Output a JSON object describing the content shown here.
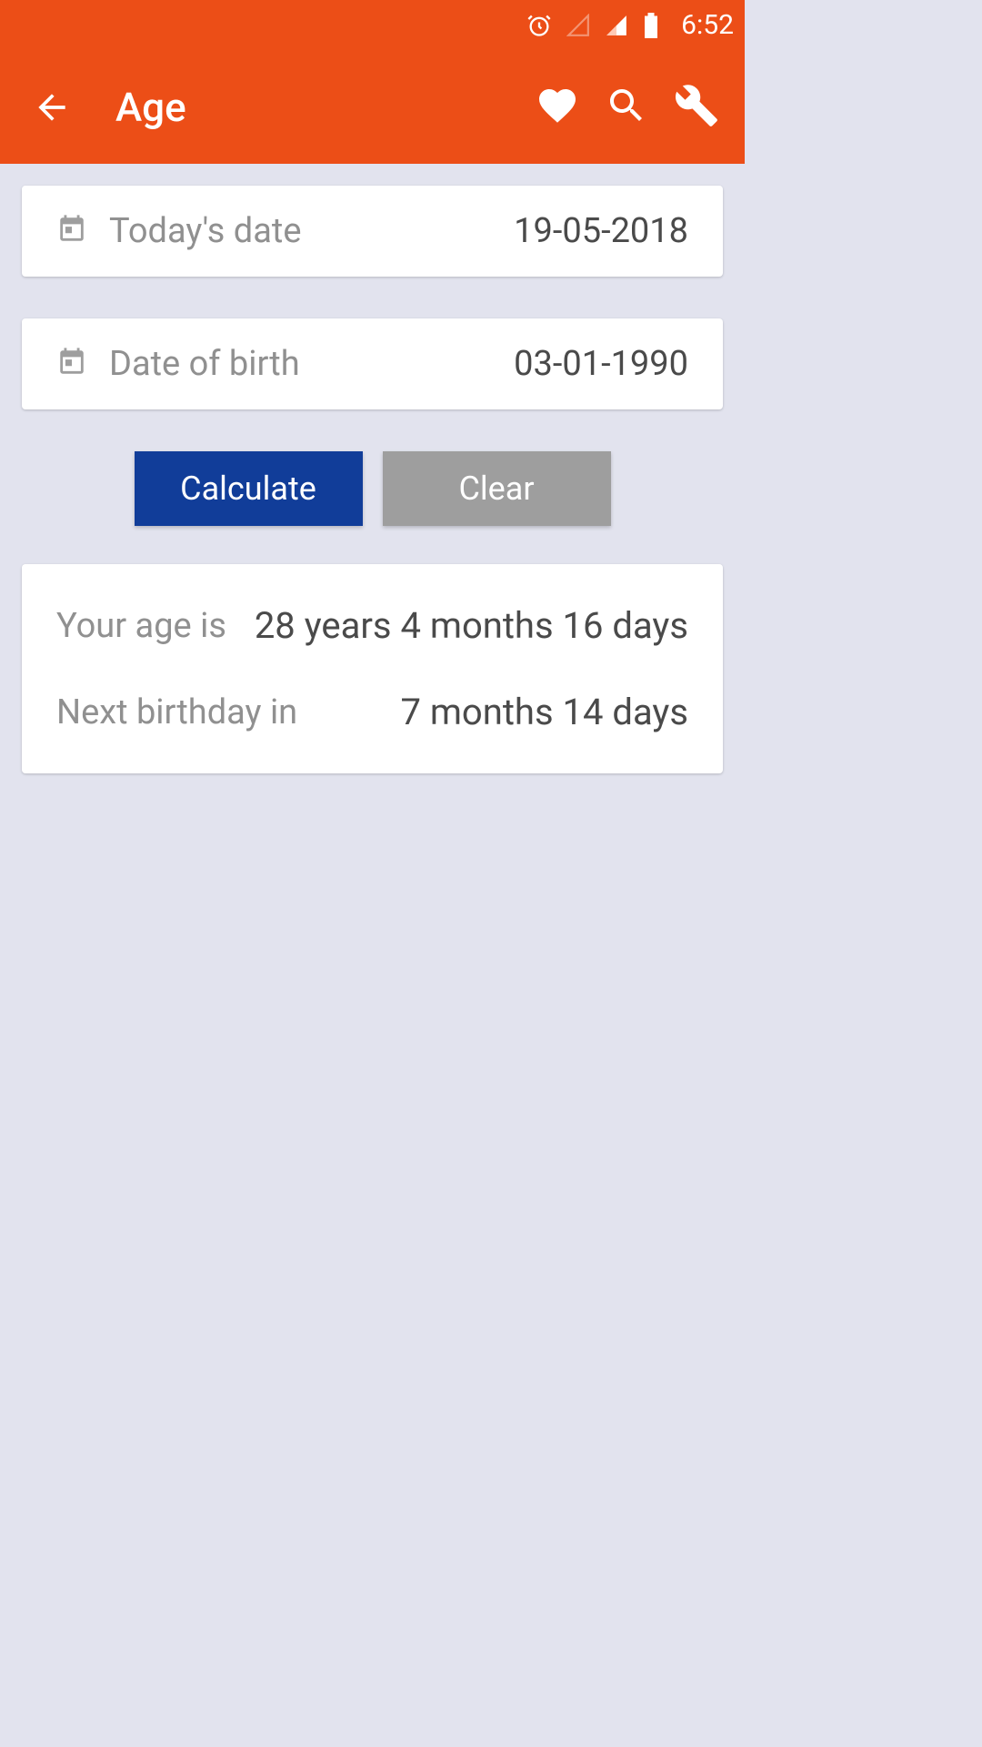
{
  "statusBar": {
    "time": "6:52"
  },
  "appBar": {
    "title": "Age"
  },
  "inputs": {
    "todayLabel": "Today's date",
    "todayValue": "19-05-2018",
    "dobLabel": "Date of birth",
    "dobValue": "03-01-1990"
  },
  "buttons": {
    "calculate": "Calculate",
    "clear": "Clear"
  },
  "results": {
    "ageLabel": "Your age is",
    "ageValue": "28 years 4 months 16 days",
    "nextLabel": "Next birthday in",
    "nextValue": "7 months 14 days"
  }
}
